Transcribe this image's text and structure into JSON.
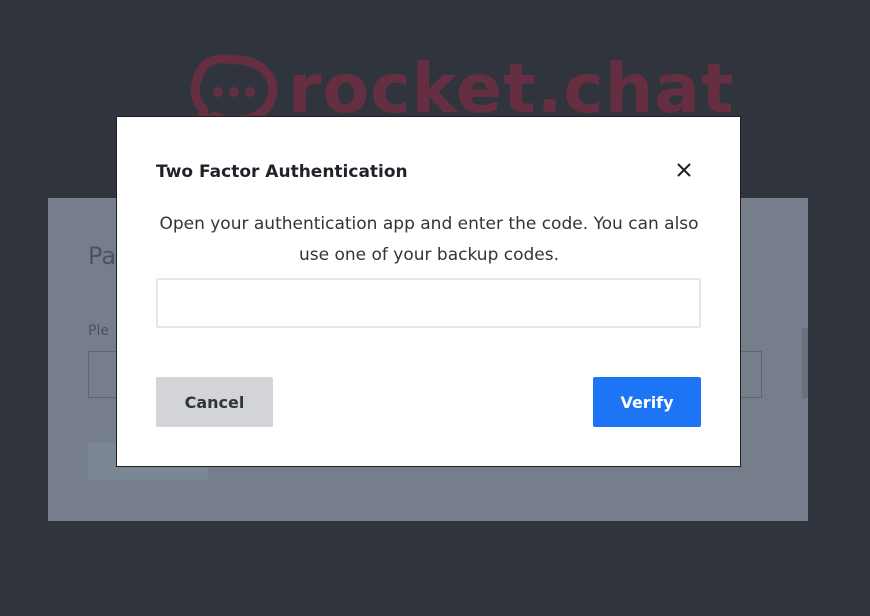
{
  "background": {
    "logo_text": "rocket.chat",
    "logo_color": "#9e2c45",
    "card_title": "Pa",
    "card_label": "Ple"
  },
  "modal": {
    "title": "Two Factor Authentication",
    "close_icon": "close-icon",
    "description": "Open your authentication app and enter the code. You can also use one of your backup codes.",
    "code_input": {
      "value": "",
      "placeholder": ""
    },
    "cancel_label": "Cancel",
    "verify_label": "Verify"
  },
  "colors": {
    "overlay_background": "#2f343d",
    "primary_button": "#1d74f5",
    "secondary_button": "#d2d4d8",
    "title_text": "#1f2329"
  }
}
